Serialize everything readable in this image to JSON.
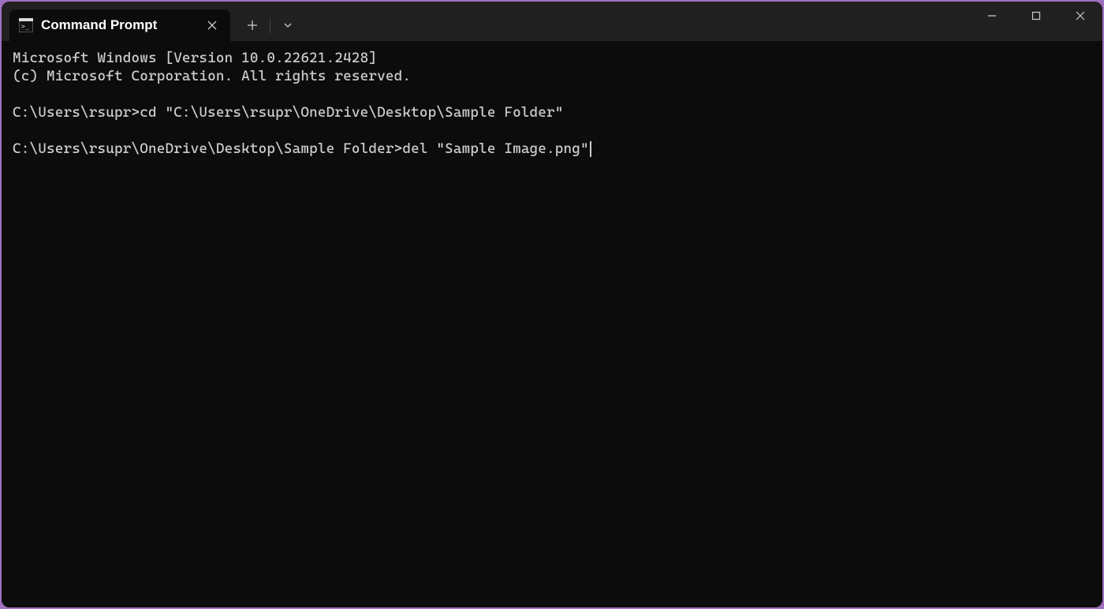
{
  "tab": {
    "title": "Command Prompt"
  },
  "terminal": {
    "line1": "Microsoft Windows [Version 10.0.22621.2428]",
    "line2": "(c) Microsoft Corporation. All rights reserved.",
    "blank1": "",
    "prompt1": "C:\\Users\\rsupr>",
    "cmd1": "cd \"C:\\Users\\rsupr\\OneDrive\\Desktop\\Sample Folder\"",
    "blank2": "",
    "prompt2": "C:\\Users\\rsupr\\OneDrive\\Desktop\\Sample Folder>",
    "cmd2": "del \"Sample Image.png\""
  }
}
